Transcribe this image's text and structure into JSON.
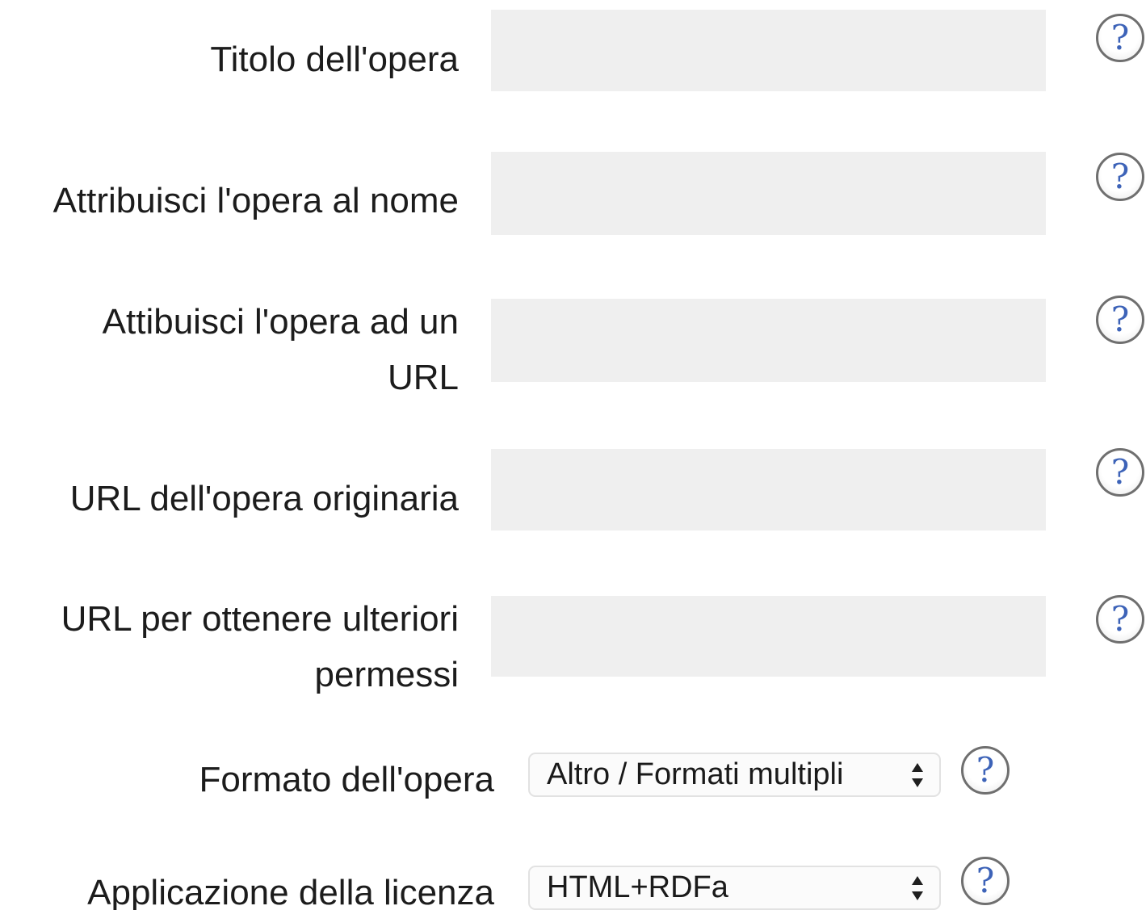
{
  "fields": [
    {
      "label": "Titolo dell'opera",
      "value": ""
    },
    {
      "label": "Attribuisci l'opera al nome",
      "value": ""
    },
    {
      "label": "Attibuisci l'opera ad un URL",
      "value": ""
    },
    {
      "label": "URL dell'opera originaria",
      "value": ""
    },
    {
      "label": "URL per ottenere ulteriori permessi",
      "value": ""
    }
  ],
  "selects": [
    {
      "label": "Formato dell'opera",
      "selected": "Altro / Formati multipli"
    },
    {
      "label": "Applicazione della licenza",
      "selected": "HTML+RDFa"
    }
  ],
  "help_glyph": "?",
  "icons": {
    "help": "question-circle-icon",
    "select_arrows": "up-down-arrows-icon"
  },
  "colors": {
    "input_background": "#efefef",
    "help_question_mark": "#3d63b8",
    "help_ring": "#6f6f6f",
    "label_text": "#1c1c1c"
  }
}
